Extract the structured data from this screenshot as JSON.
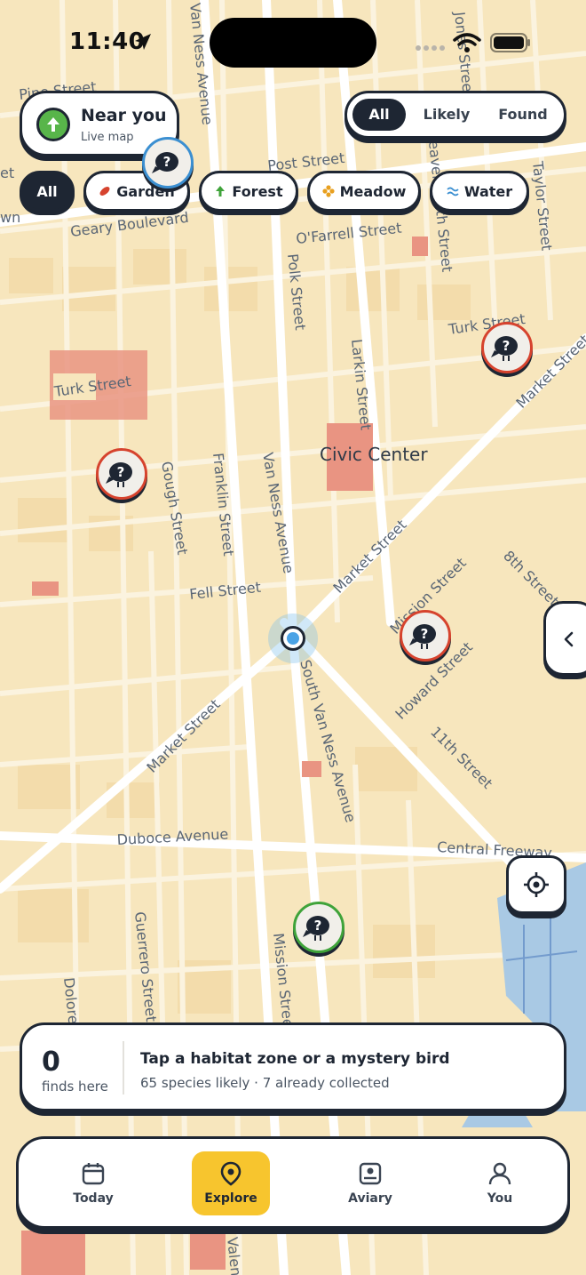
{
  "status_bar": {
    "time": "11:40",
    "icons": [
      "location-arrow-icon",
      "signal-icon",
      "wifi-icon",
      "battery-icon"
    ]
  },
  "map": {
    "labels": {
      "pine": "Pine Street",
      "van_ness_top": "Van Ness Avenue",
      "jones": "Jones Street",
      "post": "Post Street",
      "leavenworth": "Leavenworth Street",
      "taylor": "Taylor Street",
      "geary": "Geary Boulevard",
      "ofarrell": "O'Farrell Street",
      "polk": "Polk Street",
      "larkin": "Larkin Street",
      "turk_right": "Turk Street",
      "market_right": "Market Street",
      "turk_left": "Turk Street",
      "civic_center": "Civic Center",
      "franklin": "Franklin Street",
      "van_ness": "Van Ness Avenue",
      "gough": "Gough Street",
      "fell": "Fell Street",
      "market_mid": "Market Street",
      "mission": "Mission Street",
      "eighth": "8th Street",
      "howard": "Howard Street",
      "eleventh": "11th Street",
      "south_van_ness": "South Van Ness Avenue",
      "market_lower": "Market Street",
      "duboce": "Duboce Avenue",
      "central_fwy": "Central Freeway",
      "guerrero": "Guerrero Street",
      "mission_lower": "Mission Street",
      "dolores": "Dolore",
      "valencia": "Valen",
      "partial_wn": "wn",
      "partial_et": "et",
      "partial_octavia": "Street"
    }
  },
  "near_you": {
    "title": "Near you",
    "subtitle": "Live map",
    "icon": "arrow-up-icon",
    "accent": "#58b54a"
  },
  "segment": {
    "items": [
      "All",
      "Likely",
      "Found"
    ],
    "selected": "All"
  },
  "filters": {
    "selected": "All",
    "chips": [
      {
        "label": "All",
        "icon": "",
        "color": ""
      },
      {
        "label": "Garden",
        "icon": "leaf-icon",
        "color": "#d6432e"
      },
      {
        "label": "Forest",
        "icon": "tree-arrow-icon",
        "color": "#3fa33a"
      },
      {
        "label": "Meadow",
        "icon": "flower-icon",
        "color": "#e8a020"
      },
      {
        "label": "Water",
        "icon": "wave-icon",
        "color": "#3b8fd1"
      }
    ]
  },
  "markers": [
    {
      "name": "mystery-bird-marker",
      "habitat": "Water",
      "color": "#3b8fd1"
    },
    {
      "name": "mystery-bird-marker",
      "habitat": "Garden",
      "color": "#d6432e"
    },
    {
      "name": "mystery-bird-marker",
      "habitat": "Garden",
      "color": "#d6432e"
    },
    {
      "name": "mystery-bird-marker",
      "habitat": "Garden",
      "color": "#d6432e"
    },
    {
      "name": "mystery-bird-marker",
      "habitat": "Forest",
      "color": "#3fa33a"
    }
  ],
  "info_card": {
    "count": "0",
    "count_label": "finds here",
    "title": "Tap a habitat zone or a mystery bird",
    "subtitle": "65 species likely · 7 already collected"
  },
  "tabbar": {
    "selected": "Explore",
    "accent": "#f7c52e",
    "tabs": [
      {
        "label": "Today",
        "icon": "calendar-icon"
      },
      {
        "label": "Explore",
        "icon": "map-pin-icon"
      },
      {
        "label": "Aviary",
        "icon": "aviary-icon"
      },
      {
        "label": "You",
        "icon": "person-icon"
      }
    ]
  }
}
